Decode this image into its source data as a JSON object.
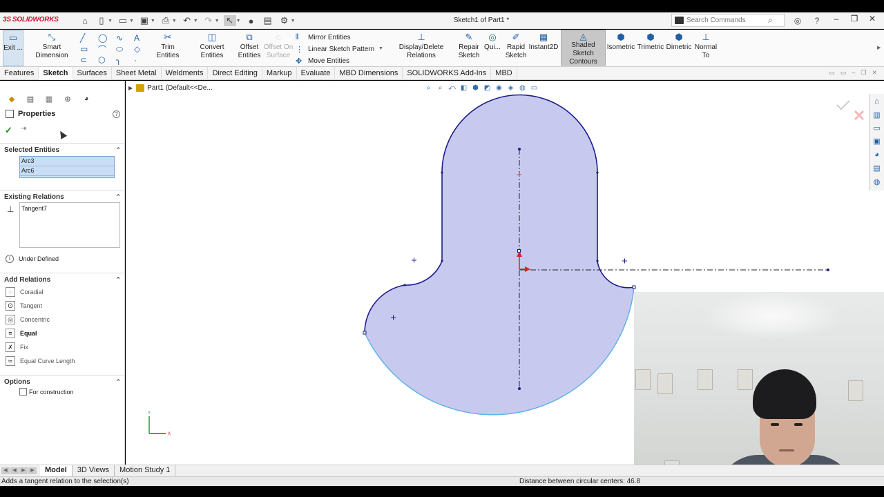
{
  "app": {
    "logo": "SOLIDWORKS",
    "doc_title": "Sketch1 of Part1 *"
  },
  "search": {
    "placeholder": "Search Commands"
  },
  "ribbon": {
    "exit": "Exit ...",
    "smart_dimension": "Smart Dimension",
    "trim": "Trim Entities",
    "convert": "Convert Entities",
    "offset": "Offset Entities",
    "offset_on_surface": "Offset On Surface",
    "mirror": "Mirror Entities",
    "linear_pattern": "Linear Sketch Pattern",
    "move": "Move Entities",
    "display_delete": "Display/Delete Relations",
    "repair": "Repair Sketch",
    "quick": "Qui...",
    "rapid": "Rapid Sketch",
    "instant2d": "Instant2D",
    "shaded": "Shaded Sketch Contours",
    "isometric": "Isometric",
    "trimetric": "Trimetric",
    "dimetric": "Dimetric",
    "normal_to": "Normal To"
  },
  "tabs": [
    "Features",
    "Sketch",
    "Surfaces",
    "Sheet Metal",
    "Weldments",
    "Direct Editing",
    "Markup",
    "Evaluate",
    "MBD Dimensions",
    "SOLIDWORKS Add-Ins",
    "MBD"
  ],
  "active_tab": "Sketch",
  "panel": {
    "title": "Properties",
    "selected_header": "Selected Entities",
    "selected": [
      "Arc3",
      "Arc6"
    ],
    "existing_header": "Existing Relations",
    "existing": [
      "Tangent7"
    ],
    "status": "Under Defined",
    "add_header": "Add Relations",
    "relations": [
      {
        "label": "Coradial",
        "icon": "coradial-icon",
        "bold": false
      },
      {
        "label": "Tangent",
        "icon": "tangent-icon",
        "bold": false
      },
      {
        "label": "Concentric",
        "icon": "concentric-icon",
        "bold": false
      },
      {
        "label": "Equal",
        "icon": "equal-icon",
        "bold": true
      },
      {
        "label": "Fix",
        "icon": "fix-icon",
        "bold": false
      },
      {
        "label": "Equal Curve Length",
        "icon": "equal-curve-length-icon",
        "bold": false
      }
    ],
    "options_header": "Options",
    "for_construction": "For construction"
  },
  "tree": {
    "part": "Part1  (Default<<De..."
  },
  "bottom_tabs": [
    "Model",
    "3D Views",
    "Motion Study 1"
  ],
  "status": {
    "left": "Adds a tangent relation to the selection(s)",
    "right": "Distance between circular centers: 46.8"
  },
  "colors": {
    "fill": "#c7c9ee",
    "edge": "#1c1c8c",
    "selected_edge": "#5ab0e8",
    "accent": "#1f5fa8"
  }
}
